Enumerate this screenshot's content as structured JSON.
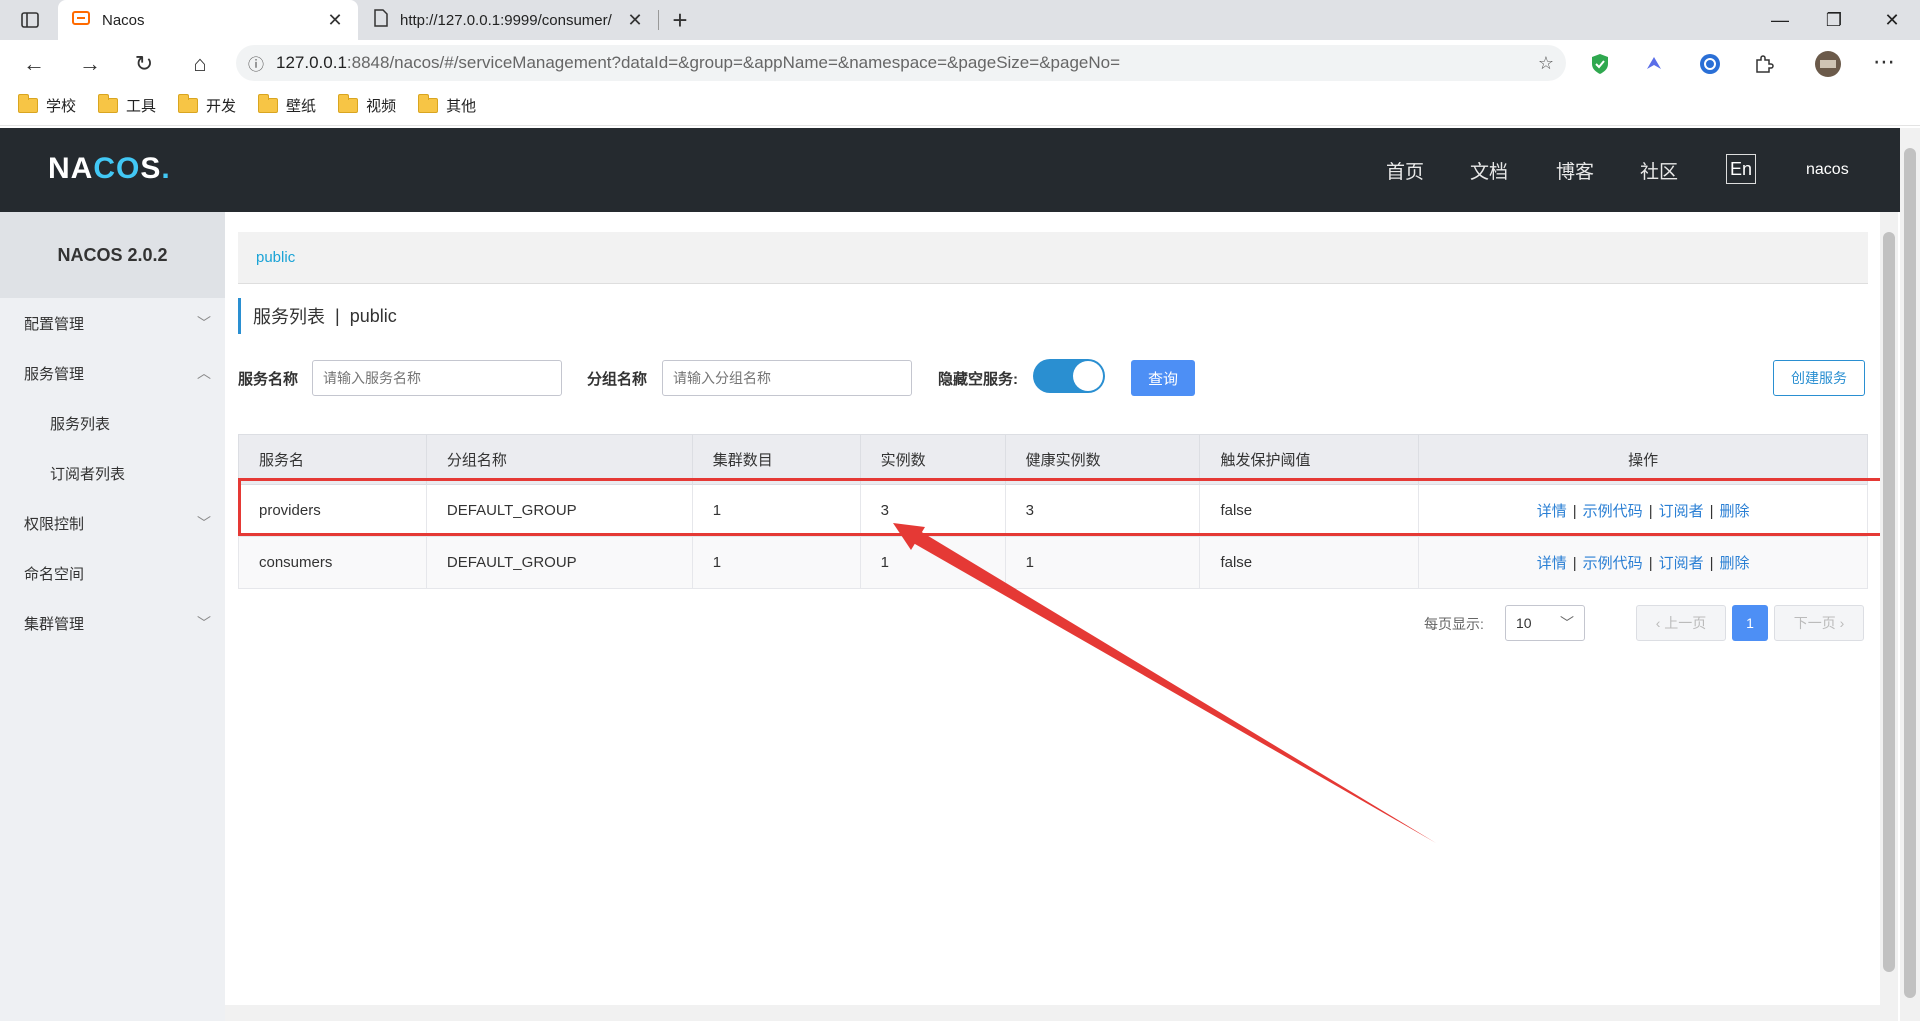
{
  "browser": {
    "tabs": [
      {
        "title": "Nacos",
        "active": true
      },
      {
        "title": "http://127.0.0.1:9999/consumer/",
        "active": false
      }
    ],
    "url_host": "127.0.0.1",
    "url_rest": ":8848/nacos/#/serviceManagement?dataId=&group=&appName=&namespace=&pageSize=&pageNo=",
    "bookmarks": [
      "学校",
      "工具",
      "开发",
      "壁纸",
      "视频",
      "其他"
    ]
  },
  "header": {
    "logo": "NACOS.",
    "nav": [
      "首页",
      "文档",
      "博客",
      "社区"
    ],
    "lang": "En",
    "user": "nacos"
  },
  "sidebar": {
    "title": "NACOS 2.0.2",
    "items": [
      {
        "label": "配置管理"
      },
      {
        "label": "服务管理"
      },
      {
        "label": "服务列表"
      },
      {
        "label": "订阅者列表"
      },
      {
        "label": "权限控制"
      },
      {
        "label": "命名空间"
      },
      {
        "label": "集群管理"
      }
    ]
  },
  "main": {
    "namespace": "public",
    "heading": "服务列表",
    "heading_sep": "|",
    "heading_ns": "public",
    "filters": {
      "service_name_label": "服务名称",
      "service_name_placeholder": "请输入服务名称",
      "group_name_label": "分组名称",
      "group_name_placeholder": "请输入分组名称",
      "hide_empty_label": "隐藏空服务:",
      "hide_empty_on": true,
      "query_button": "查询",
      "create_button": "创建服务"
    },
    "table": {
      "columns": [
        "服务名",
        "分组名称",
        "集群数目",
        "实例数",
        "健康实例数",
        "触发保护阈值",
        "操作"
      ],
      "rows": [
        {
          "name": "providers",
          "group": "DEFAULT_GROUP",
          "clusters": "1",
          "instances": "3",
          "healthy": "3",
          "threshold": "false"
        },
        {
          "name": "consumers",
          "group": "DEFAULT_GROUP",
          "clusters": "1",
          "instances": "1",
          "healthy": "1",
          "threshold": "false"
        }
      ],
      "actions": [
        "详情",
        "示例代码",
        "订阅者",
        "删除"
      ],
      "action_sep": "|"
    },
    "pager": {
      "per_page_label": "每页显示:",
      "page_size": "10",
      "prev": "上一页",
      "current": "1",
      "next": "下一页"
    }
  },
  "colors": {
    "header_bg": "#252a2f",
    "accent": "#4d8ff5",
    "annotation": "#e53935"
  }
}
